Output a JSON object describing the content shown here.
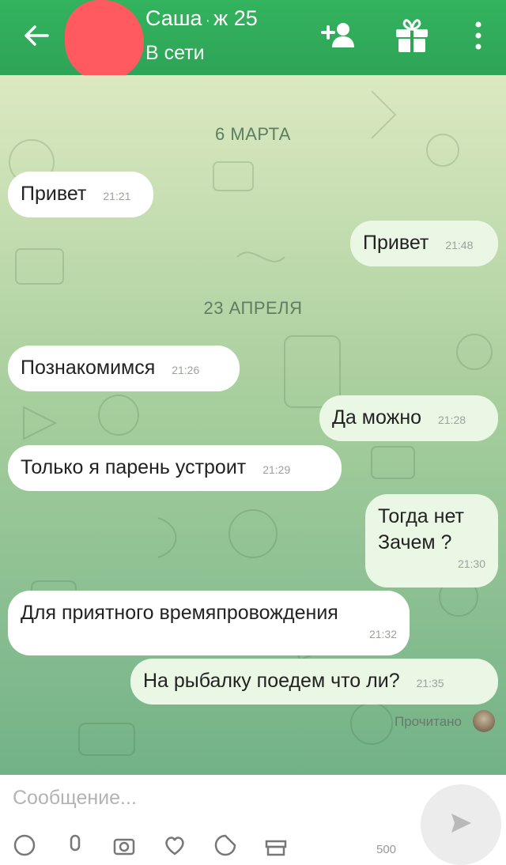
{
  "header": {
    "name": "Саша",
    "details": "ж 25",
    "status": "В сети",
    "colors": {
      "bar": "#2ea457",
      "redaction": "#ff5a5f"
    },
    "icons": [
      "back-arrow-icon",
      "add-friend-icon",
      "gift-icon",
      "more-vertical-icon"
    ]
  },
  "chat": {
    "date_1": "6 МАРТА",
    "date_2": "23 АПРЕЛЯ",
    "messages": [
      {
        "dir": "in",
        "text": "Привет",
        "time": "21:21"
      },
      {
        "dir": "out",
        "text": "Привет",
        "time": "21:48"
      },
      {
        "dir": "in",
        "text": "Познакомимся",
        "time": "21:26"
      },
      {
        "dir": "out",
        "text": "Да можно",
        "time": "21:28"
      },
      {
        "dir": "in",
        "text": "Только я парень устроит",
        "time": "21:29"
      },
      {
        "dir": "out",
        "line1": "Тогда нет",
        "line2": "Зачем ?",
        "time": "21:30"
      },
      {
        "dir": "in",
        "text": "Для приятного времяпровождения",
        "time": "21:32"
      },
      {
        "dir": "out",
        "text": "На рыбалку поедем что ли?",
        "time": "21:35"
      }
    ],
    "read_status": "Прочитано"
  },
  "composer": {
    "placeholder": "Сообщение...",
    "counter": "500",
    "icons": [
      "emoji-icon",
      "microphone-icon",
      "camera-icon",
      "heart-icon",
      "sticker-icon",
      "gift-icon",
      "send-icon"
    ]
  }
}
